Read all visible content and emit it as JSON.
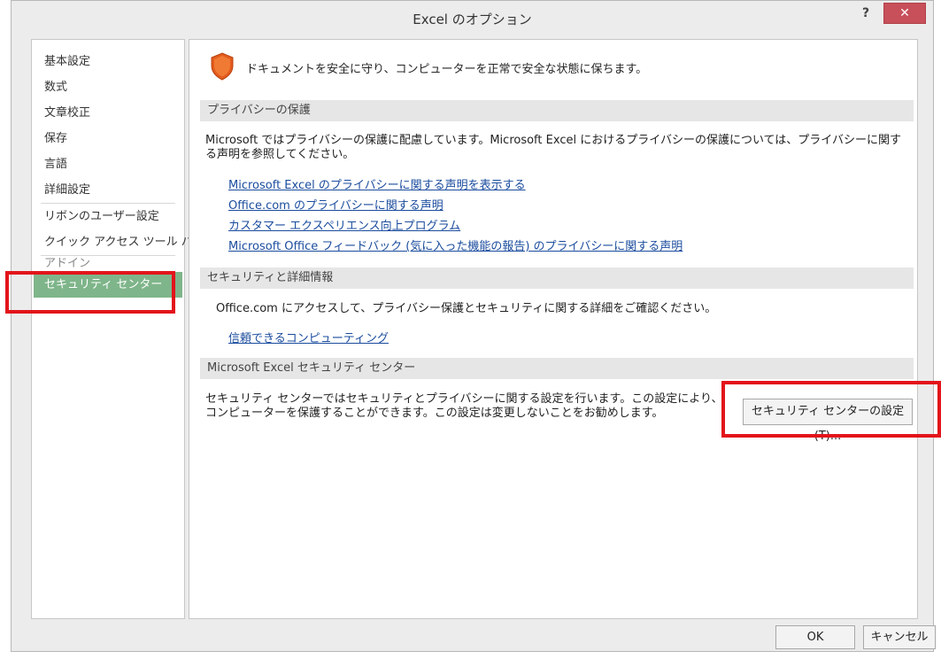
{
  "window": {
    "title": "Excel のオプション",
    "help_label": "?",
    "close_label": "✕"
  },
  "sidebar": {
    "items": [
      {
        "label": "基本設定"
      },
      {
        "label": "数式"
      },
      {
        "label": "文章校正"
      },
      {
        "label": "保存"
      },
      {
        "label": "言語"
      },
      {
        "label": "詳細設定"
      },
      {
        "label": "リボンのユーザー設定"
      },
      {
        "label": "クイック アクセス ツール バー"
      },
      {
        "label": "アドイン"
      },
      {
        "label": "セキュリティ センター"
      }
    ]
  },
  "main": {
    "banner_icon": "shield-icon",
    "banner_text": "ドキュメントを安全に守り、コンピューターを正常で安全な状態に保ちます。",
    "privacy": {
      "header": "プライバシーの保護",
      "description": "Microsoft ではプライバシーの保護に配慮しています。Microsoft Excel におけるプライバシーの保護については、プライバシーに関する声明を参照してください。",
      "links": [
        "Microsoft Excel のプライバシーに関する声明を表示する",
        "Office.com のプライバシーに関する声明",
        "カスタマー エクスペリエンス向上プログラム",
        "Microsoft Office フィードバック (気に入った機能の報告) のプライバシーに関する声明"
      ]
    },
    "security": {
      "header": "セキュリティと詳細情報",
      "description": "Office.com にアクセスして、プライバシー保護とセキュリティに関する詳細をご確認ください。",
      "link": "信頼できるコンピューティング"
    },
    "trust_center": {
      "header": "Microsoft Excel セキュリティ センター",
      "description": "セキュリティ センターではセキュリティとプライバシーに関する設定を行います。この設定により、コンピューターを保護することができます。この設定は変更しないことをお勧めします。",
      "button_label": "セキュリティ センターの設定(T)..."
    }
  },
  "footer": {
    "ok_label": "OK",
    "cancel_label": "キャンセル"
  },
  "colors": {
    "selected_nav": "#7fb58a",
    "highlight": "#e3141b",
    "link": "#1a4c9e",
    "shield": "#e35b1e"
  }
}
